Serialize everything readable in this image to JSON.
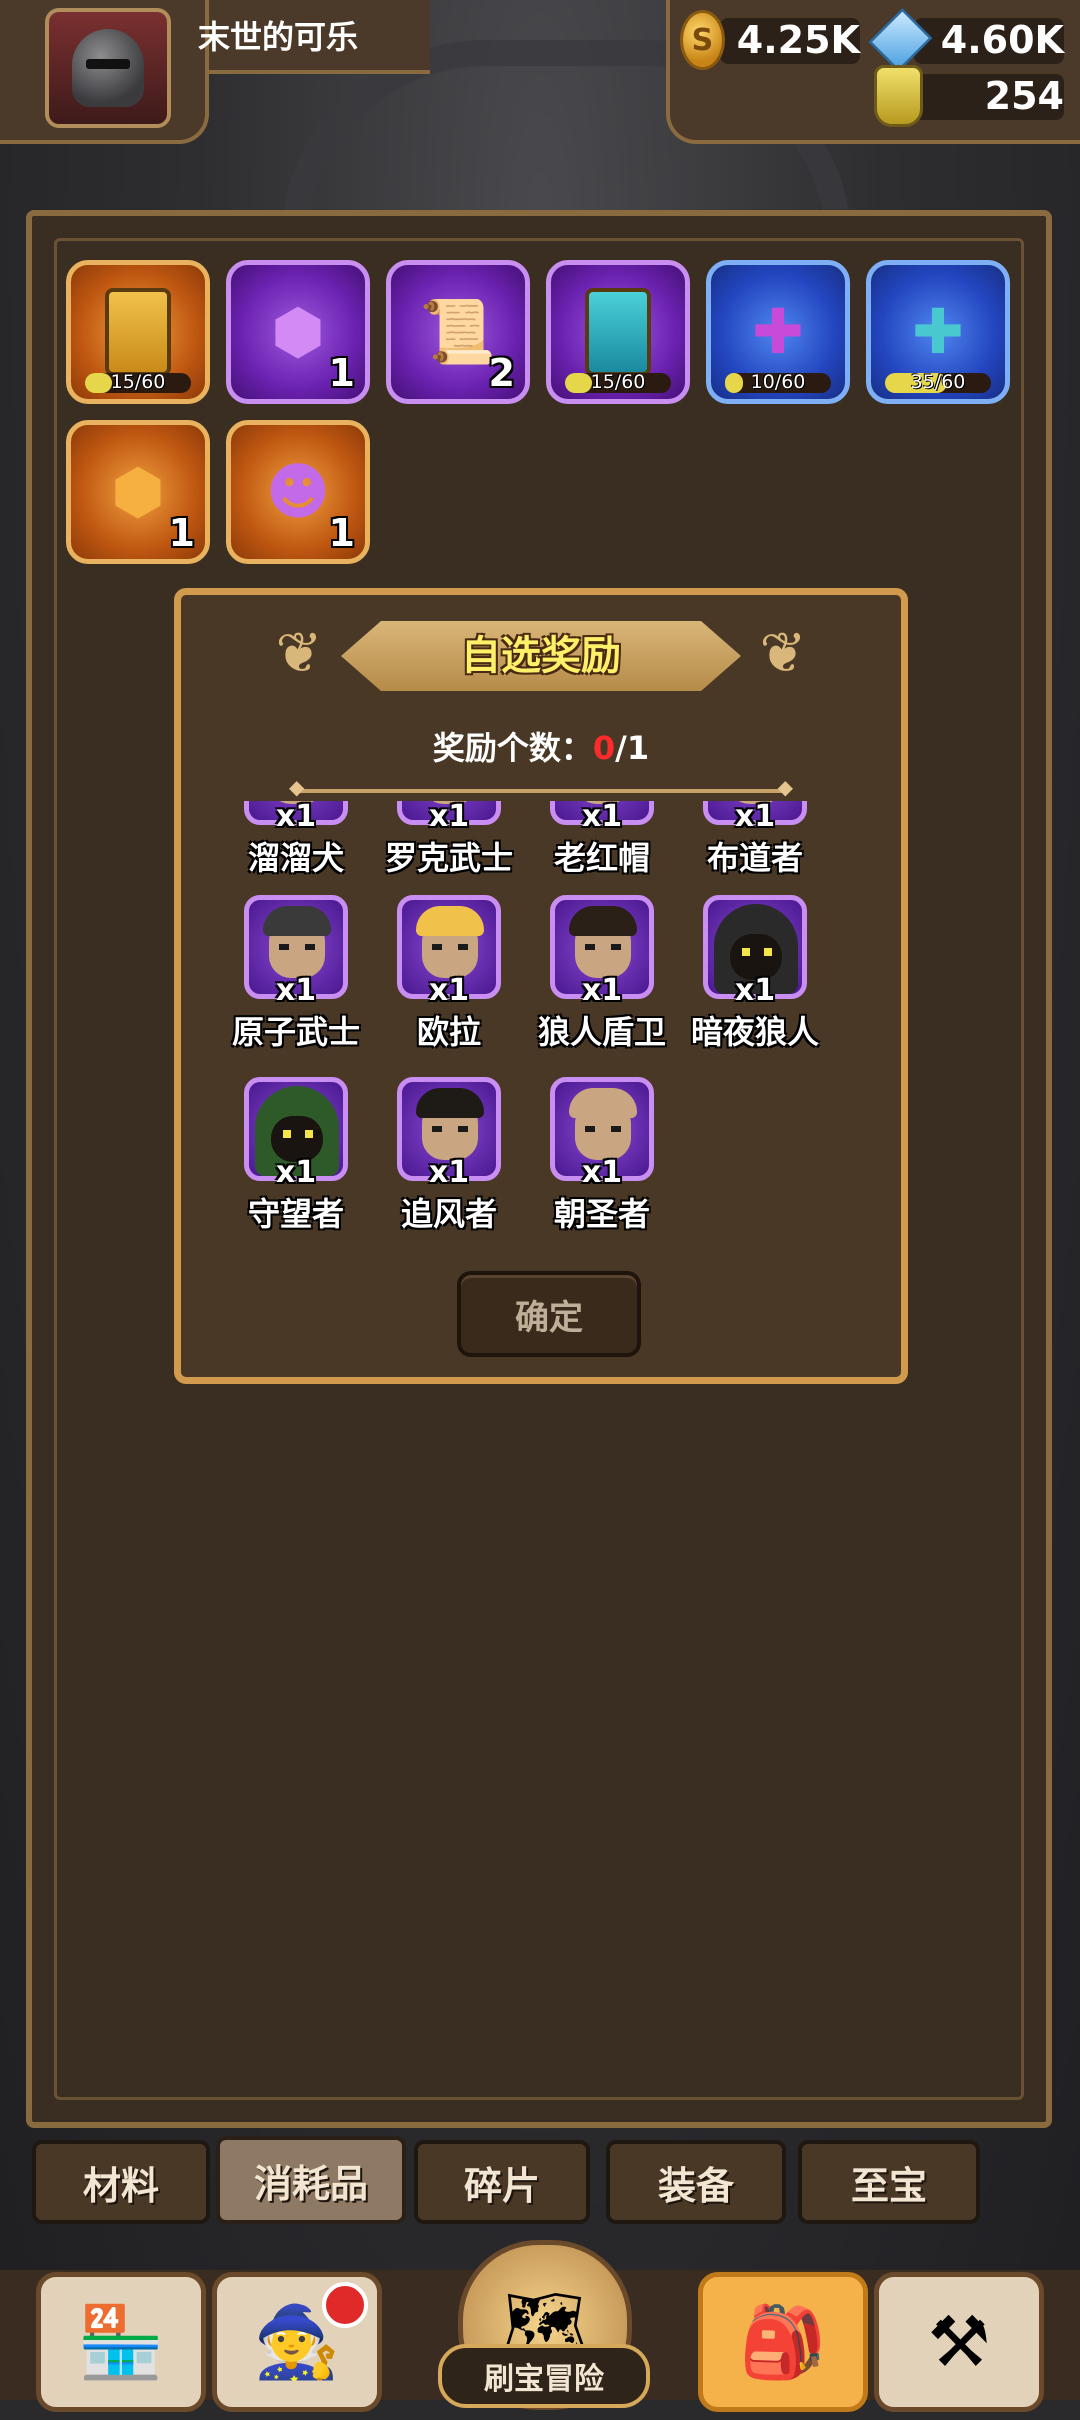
{
  "header": {
    "player_name": "末世的可乐",
    "coins": "4.25K",
    "gems": "4.60K",
    "potions": "254"
  },
  "inventory": {
    "items": [
      {
        "name": "gold-card",
        "rarity": "orange",
        "progress_text": "15/60",
        "progress": 0.25,
        "icon": "card"
      },
      {
        "name": "purple-cube",
        "rarity": "purple",
        "count": "1",
        "icon": "cube"
      },
      {
        "name": "map-scroll",
        "rarity": "purple",
        "count": "2",
        "icon": "scroll"
      },
      {
        "name": "teal-card",
        "rarity": "purple",
        "progress_text": "15/60",
        "progress": 0.25,
        "icon": "card"
      },
      {
        "name": "purple-puzzle",
        "rarity": "blue",
        "progress_text": "10/60",
        "progress": 0.1667,
        "icon": "puzzle"
      },
      {
        "name": "teal-puzzle",
        "rarity": "blue",
        "progress_text": "35/60",
        "progress": 0.5833,
        "icon": "puzzle"
      },
      {
        "name": "orange-cube",
        "rarity": "orange",
        "count": "1",
        "icon": "cube"
      },
      {
        "name": "gingerbread",
        "rarity": "orange",
        "count": "1",
        "icon": "gingerbread"
      }
    ]
  },
  "dialog": {
    "title": "自选奖励",
    "reward_label": "奖励个数：",
    "reward_current": "0",
    "reward_sep_total": "/1",
    "confirm_label": "确定",
    "heroes": [
      {
        "name": "溜溜犬",
        "qty": "x1",
        "style": "partial"
      },
      {
        "name": "罗克武士",
        "qty": "x1",
        "style": "partial"
      },
      {
        "name": "老红帽",
        "qty": "x1",
        "style": "partial"
      },
      {
        "name": "布道者",
        "qty": "x1",
        "style": "partial"
      },
      {
        "name": "原子武士",
        "qty": "x1",
        "style": "face",
        "hair": "#3a3a3a"
      },
      {
        "name": "欧拉",
        "qty": "x1",
        "style": "face",
        "hair": "#f1c24a"
      },
      {
        "name": "狼人盾卫",
        "qty": "x1",
        "style": "face",
        "hair": "#2a2018"
      },
      {
        "name": "暗夜狼人",
        "qty": "x1",
        "style": "hood",
        "hood": "#2a2a2a"
      },
      {
        "name": "守望者",
        "qty": "x1",
        "style": "hood",
        "hood": "#2e5a2a"
      },
      {
        "name": "追风者",
        "qty": "x1",
        "style": "face",
        "hair": "#1e1a16"
      },
      {
        "name": "朝圣者",
        "qty": "x1",
        "style": "face",
        "hair": "#c9a582"
      }
    ]
  },
  "tabs": [
    {
      "label": "材料",
      "active": false
    },
    {
      "label": "消耗品",
      "active": true
    },
    {
      "label": "碎片",
      "active": false
    },
    {
      "label": "装备",
      "active": false
    },
    {
      "label": "至宝",
      "active": false
    }
  ],
  "bottom_nav": {
    "center_label": "刷宝冒险",
    "items": [
      "shop",
      "heroes",
      "adventure",
      "backpack",
      "forge"
    ],
    "active": "backpack",
    "notification_on": "heroes"
  },
  "colors": {
    "panel_border": "#8a6a3f",
    "dialog_border": "#d19a4c",
    "title_text": "#fff06a",
    "reward_current": "#ff2b2b"
  }
}
